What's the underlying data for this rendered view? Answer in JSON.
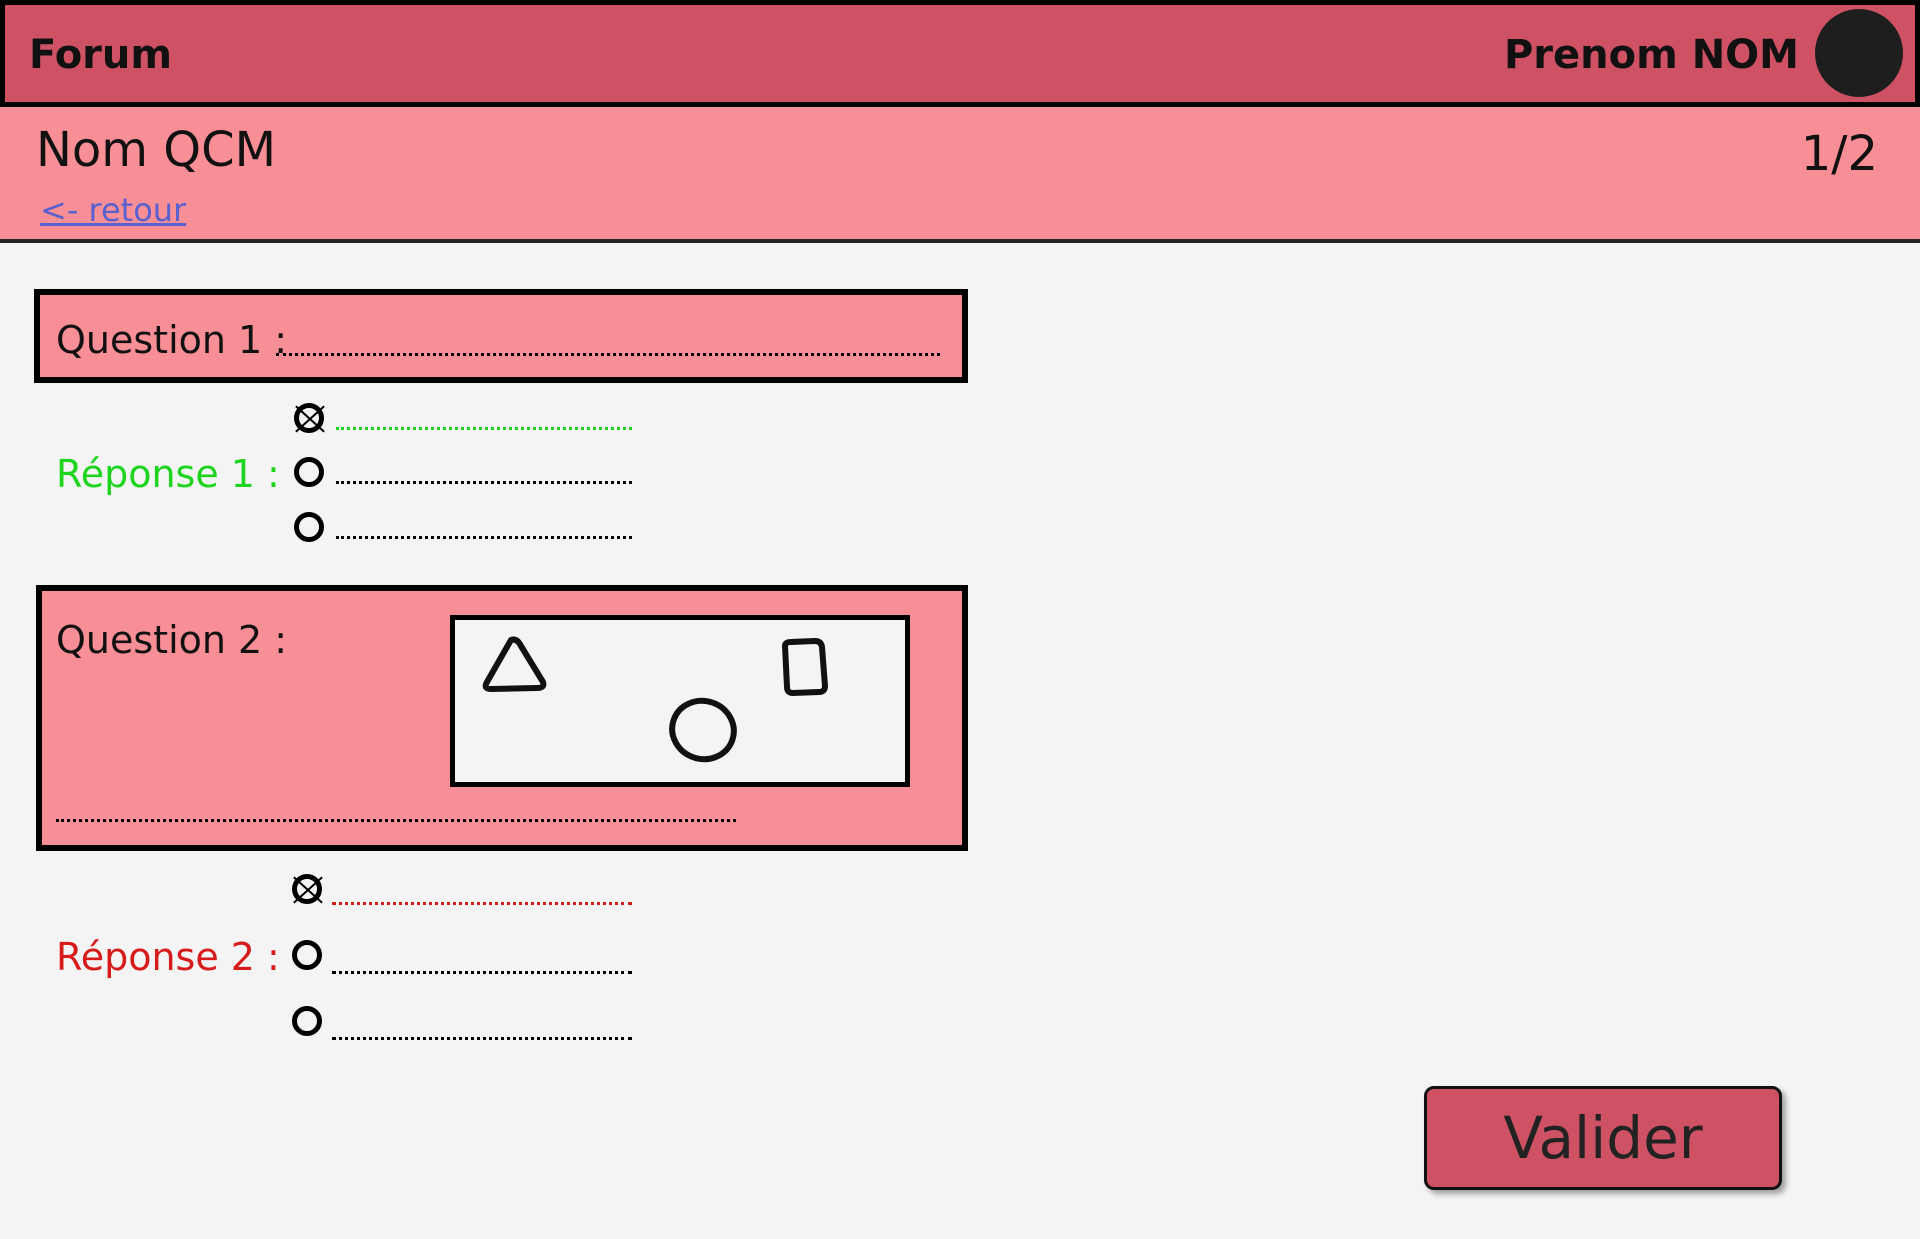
{
  "header": {
    "brand": "Forum",
    "user_name": "Prenom NOM",
    "avatar_icon": "user-avatar-icon",
    "bar_color": "#cf5264"
  },
  "subheader": {
    "title": "Nom QCM",
    "back_link": "<- retour",
    "page_indicator": "1/2",
    "bg_color": "#f88f96"
  },
  "questions": [
    {
      "label": "Question 1 :",
      "response_label": "Réponse 1 :",
      "response_color": "#1ed41e",
      "options": [
        {
          "selected": true
        },
        {
          "selected": false
        },
        {
          "selected": false
        }
      ]
    },
    {
      "label": "Question 2 :",
      "figure_icons": [
        "triangle-icon",
        "circle-icon",
        "square-icon"
      ],
      "response_label": "Réponse 2 :",
      "response_color": "#d71b1b",
      "options": [
        {
          "selected": true
        },
        {
          "selected": false
        },
        {
          "selected": false
        }
      ]
    }
  ],
  "submit": {
    "label": "Valider"
  }
}
